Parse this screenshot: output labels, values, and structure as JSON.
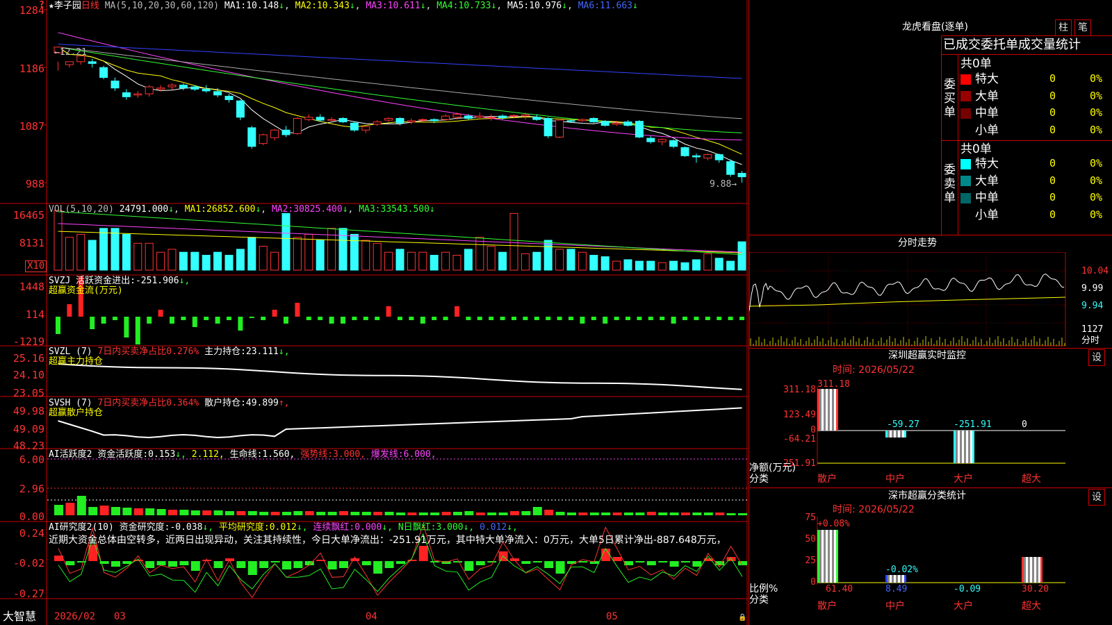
{
  "main": {
    "ma_header": {
      "star": "★",
      "name": "李子园",
      "period": "日线",
      "ma_label": "MA(5,10,20,30,60,120)",
      "ma1_label": "MA1:",
      "ma1": "10.148",
      "ma2_label": "MA2:",
      "ma2": "10.343",
      "ma3_label": "MA3:",
      "ma3": "10.611",
      "ma4_label": "MA4:",
      "ma4": "10.733",
      "ma5_label": "MA5:",
      "ma5": "10.976",
      "ma6_label": "MA6:",
      "ma6": "11.663",
      "down": "↓"
    },
    "y_labels": [
      "1284",
      "1186",
      "1087",
      "988"
    ],
    "high_marker": "←12.21",
    "low_marker": "9.88→",
    "corner_mark": "?"
  },
  "vol": {
    "header": {
      "name": "VOL(5,10,20)",
      "val": "24791.000",
      "ma1_label": "MA1:",
      "ma1": "26852.600",
      "ma2_label": "MA2:",
      "ma2": "30825.400",
      "ma3_label": "MA3:",
      "ma3": "33543.500",
      "down": "↓"
    },
    "y_labels": [
      "16465",
      "8131"
    ],
    "unit": "X10"
  },
  "svzj": {
    "header": {
      "name": "SVZJ",
      "label": "活跃资金进出:",
      "val": "-251.906",
      "down": "↓,"
    },
    "sub": "超赢资金流(万元)",
    "y_labels": [
      "1448",
      "114",
      "-1219"
    ]
  },
  "svzl": {
    "header": {
      "name": "SVZL (7)",
      "label": "7日内买卖净占比0.276%",
      "label2": "主力持仓:",
      "val": "23.111",
      "down": "↓,"
    },
    "sub": "超赢主力持仓",
    "y_labels": [
      "25.16",
      "24.10",
      "23.05"
    ]
  },
  "svsh": {
    "header": {
      "name": "SVSH (7)",
      "label": "7日内买卖净占比0.364%",
      "label2": "散户持仓:",
      "val": "49.899",
      "up": "↑,"
    },
    "sub": "超赢散户持仓",
    "y_labels": [
      "49.98",
      "49.09",
      "48.23"
    ]
  },
  "ai1": {
    "header": {
      "name": "AI活跃度2",
      "label": "资金活跃度:",
      "val": "0.153",
      "down": "↓,",
      "val2": "2.112,",
      "label3": "生命线:",
      "val3": "1.560,",
      "label4": "强势线:",
      "val4": "3.000,",
      "label5": "爆发线:",
      "val5": "6.000,"
    },
    "y_labels": [
      "6.00",
      "2.96",
      "0.00"
    ]
  },
  "ai2": {
    "header": {
      "name": "AI研究度2(10)",
      "label": "资金研究度:",
      "val": "-0.038",
      "down": "↓,",
      "label2": "平均研究度:",
      "val2": "0.012",
      "label3": "连续飘红:",
      "val3": "0.000",
      "label4": "N日飘红:",
      "val4": "3.000",
      "val5": "0.012"
    },
    "text": "近期大资金总体由空转多，近两日出现异动，关注其持续性，今日大单净流出：-251.91万元，其中特大单净流入：0万元，大单5日累计净出-887.648万元，",
    "y_labels": [
      "0.24",
      "-0.02",
      "-0.27"
    ]
  },
  "bottom": {
    "logo": "大智慧",
    "dates": [
      "2026/02",
      "03",
      "04",
      "05"
    ],
    "lock": "🔒"
  },
  "dragon": {
    "title": "龙虎看盘(逐单)",
    "btn1": "柱",
    "btn2": "笔",
    "subtitle": "已成交委托单成交量统计",
    "buy": {
      "total": "共0单",
      "side": "委买单",
      "rows": [
        {
          "label": "特大",
          "val": "0",
          "pct": "0%",
          "color": "#ff0000"
        },
        {
          "label": "大单",
          "val": "0",
          "pct": "0%",
          "color": "#990000"
        },
        {
          "label": "中单",
          "val": "0",
          "pct": "0%",
          "color": "#770000"
        },
        {
          "label": "小单",
          "val": "0",
          "pct": "0%",
          "color": "#000000"
        }
      ]
    },
    "sell": {
      "total": "共0单",
      "side": "委卖单",
      "rows": [
        {
          "label": "特大",
          "val": "0",
          "pct": "0%",
          "color": "#00ffff"
        },
        {
          "label": "大单",
          "val": "0",
          "pct": "0%",
          "color": "#008888"
        },
        {
          "label": "中单",
          "val": "0",
          "pct": "0%",
          "color": "#006666"
        },
        {
          "label": "小单",
          "val": "0",
          "pct": "0%",
          "color": "#000000"
        }
      ]
    }
  },
  "intraday": {
    "title": "分时走势",
    "prices": [
      "10.04",
      "9.99",
      "9.94"
    ],
    "vol_label": "1127",
    "vol_unit": "分时"
  },
  "monitor": {
    "title": "深圳超赢实时监控",
    "btn": "设",
    "date": "时间: 2026/05/22",
    "y_labels": [
      "311.18",
      "123.49",
      "0",
      "-64.21",
      "-251.91"
    ],
    "axis_label": "净额(万元)",
    "cat_label": "分类",
    "cats": [
      "散户",
      "中户",
      "大户",
      "超大"
    ],
    "values": [
      "311.18",
      "-59.27",
      "-251.91",
      "0"
    ]
  },
  "classify": {
    "title": "深市超赢分类统计",
    "btn": "设",
    "date": "时间: 2026/05/22",
    "y_labels": [
      "75",
      "50",
      "25",
      "0"
    ],
    "axis_label": "比例%",
    "cat_label": "分类",
    "cats": [
      "散户",
      "中户",
      "大户",
      "超大"
    ],
    "top_vals": [
      "+0.08%",
      "-0.02%"
    ],
    "values": [
      "61.40",
      "8.49",
      "-0.09",
      "30.20"
    ]
  },
  "chart_data": {
    "type": "candlestick",
    "y_range": [
      988,
      1284
    ],
    "x_labels": [
      "2026/02",
      "03",
      "04",
      "05"
    ],
    "high_marker": "12.21",
    "low_marker": "9.88",
    "ma_last": {
      "MA1": 10.148,
      "MA2": 10.343,
      "MA3": 10.611,
      "MA4": 10.733,
      "MA5": 10.976,
      "MA6": 11.663
    },
    "ohlc": [
      [
        12.1,
        12.2,
        11.95,
        11.8
      ],
      [
        11.9,
        11.95,
        11.95,
        11.85
      ],
      [
        11.95,
        12.05,
        12.0,
        11.9
      ],
      [
        11.95,
        11.92,
        12.0,
        11.85
      ],
      [
        11.85,
        11.68,
        11.88,
        11.65
      ],
      [
        11.62,
        11.5,
        11.68,
        11.45
      ],
      [
        11.42,
        11.35,
        11.48,
        11.3
      ],
      [
        11.38,
        11.4,
        11.45,
        11.33
      ],
      [
        11.4,
        11.52,
        11.55,
        11.35
      ],
      [
        11.48,
        11.5,
        11.55,
        11.44
      ],
      [
        11.52,
        11.55,
        11.58,
        11.47
      ],
      [
        11.55,
        11.5,
        11.58,
        11.46
      ],
      [
        11.52,
        11.48,
        11.55,
        11.45
      ],
      [
        11.48,
        11.45,
        11.55,
        11.42
      ],
      [
        11.44,
        11.38,
        11.5,
        11.34
      ],
      [
        11.36,
        11.3,
        11.4,
        11.25
      ],
      [
        11.28,
        11.0,
        11.3,
        10.95
      ],
      [
        10.82,
        10.5,
        10.85,
        10.46
      ],
      [
        10.55,
        10.7,
        10.72,
        10.52
      ],
      [
        10.65,
        10.78,
        10.8,
        10.6
      ],
      [
        10.78,
        10.7,
        10.85,
        10.66
      ],
      [
        10.72,
        10.98,
        11.0,
        10.7
      ],
      [
        10.96,
        11.0,
        11.05,
        10.93
      ],
      [
        11.0,
        10.95,
        11.05,
        10.92
      ],
      [
        10.96,
        10.96,
        11.0,
        10.93
      ],
      [
        10.98,
        10.92,
        11.0,
        10.9
      ],
      [
        10.9,
        10.78,
        10.93,
        10.75
      ],
      [
        10.78,
        10.84,
        10.86,
        10.73
      ],
      [
        10.88,
        10.92,
        10.95,
        10.85
      ],
      [
        10.95,
        10.98,
        11.0,
        10.92
      ],
      [
        10.98,
        10.9,
        11.0,
        10.86
      ],
      [
        10.92,
        10.94,
        10.98,
        10.88
      ],
      [
        10.95,
        10.96,
        10.98,
        10.92
      ],
      [
        10.96,
        10.94,
        10.98,
        10.9
      ],
      [
        10.96,
        11.02,
        11.05,
        10.94
      ],
      [
        11.0,
        11.05,
        11.08,
        10.96
      ],
      [
        11.02,
        10.98,
        11.05,
        10.95
      ],
      [
        11.0,
        11.02,
        11.08,
        10.96
      ],
      [
        11.0,
        11.0,
        11.05,
        10.94
      ],
      [
        11.02,
        10.99,
        11.05,
        10.96
      ],
      [
        11.02,
        11.03,
        11.05,
        10.98
      ],
      [
        11.02,
        11.04,
        11.08,
        10.96
      ],
      [
        11.0,
        10.96,
        11.05,
        10.94
      ],
      [
        10.98,
        10.68,
        11.0,
        10.64
      ],
      [
        10.66,
        10.95,
        10.98,
        10.64
      ],
      [
        10.94,
        10.93,
        10.97,
        10.9
      ],
      [
        10.94,
        10.96,
        10.98,
        10.92
      ],
      [
        10.98,
        10.92,
        11.0,
        10.9
      ],
      [
        10.93,
        10.86,
        10.95,
        10.84
      ],
      [
        10.88,
        10.9,
        10.94,
        10.85
      ],
      [
        10.92,
        10.86,
        10.95,
        10.84
      ],
      [
        10.93,
        10.66,
        10.95,
        10.64
      ],
      [
        10.64,
        10.58,
        10.68,
        10.55
      ],
      [
        10.58,
        10.62,
        10.64,
        10.52
      ],
      [
        10.6,
        10.5,
        10.62,
        10.47
      ],
      [
        10.48,
        10.34,
        10.5,
        10.32
      ],
      [
        10.34,
        10.32,
        10.38,
        10.22
      ],
      [
        10.3,
        10.36,
        10.38,
        10.26
      ],
      [
        10.36,
        10.27,
        10.38,
        10.22
      ],
      [
        10.24,
        10.02,
        10.28,
        9.98
      ],
      [
        10.04,
        9.98,
        10.08,
        9.88
      ]
    ]
  }
}
